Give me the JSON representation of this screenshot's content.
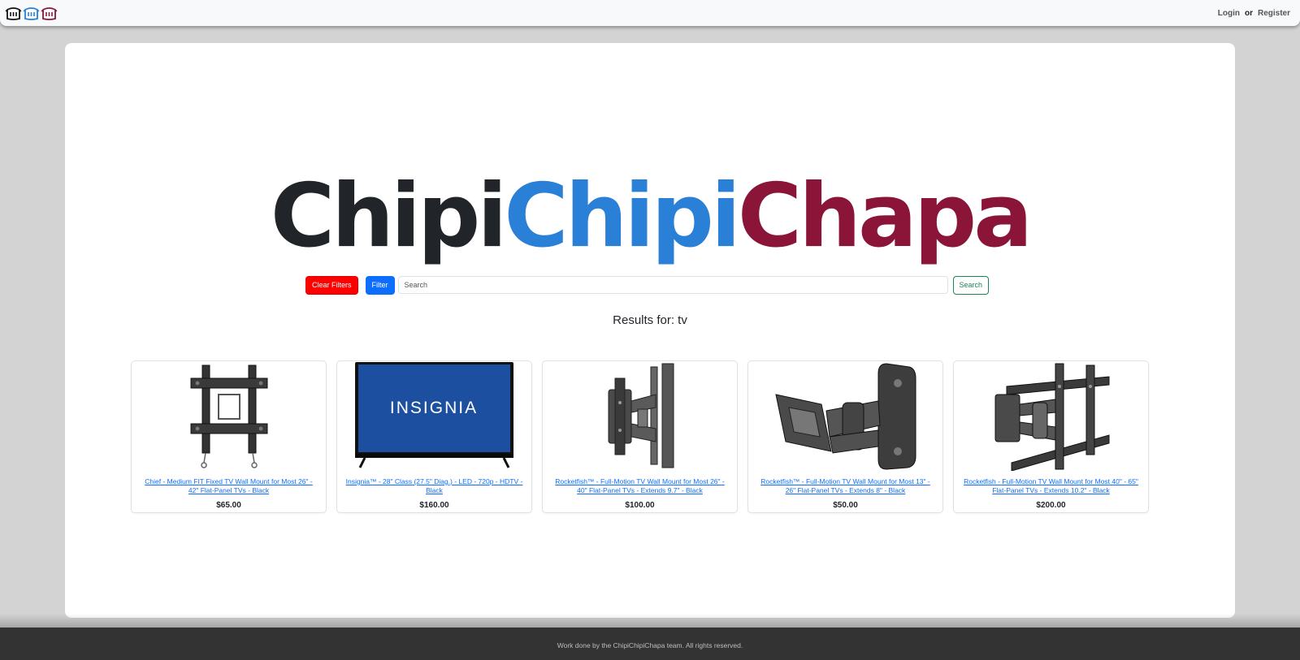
{
  "navbar": {
    "logo_icons": [
      "pot-icon-black",
      "pot-icon-blue",
      "pot-icon-maroon"
    ],
    "login_label": "Login",
    "or_label": "or",
    "register_label": "Register"
  },
  "brand": {
    "word1": "Chipi",
    "word2": "Chipi",
    "word3": "Chapa",
    "colors": [
      "#212529",
      "#2a7fd6",
      "#8b1538"
    ]
  },
  "search": {
    "clear_filters_label": "Clear Filters",
    "filter_label": "Filter",
    "placeholder": "Search",
    "value": "",
    "search_label": "Search"
  },
  "results": {
    "title": "Results for: tv"
  },
  "products": [
    {
      "name": "Chief - Medium FIT Fixed TV Wall Mount for Most 26\" - 42\" Flat-Panel TVs - Black",
      "price": "$65.00",
      "image": "fixed-wall-mount-image"
    },
    {
      "name": "Insignia™ - 28\" Class (27.5\" Diag.) - LED - 720p - HDTV - Black",
      "price": "$160.00",
      "image": "insignia-tv-image",
      "screen_text": "INSIGNIA"
    },
    {
      "name": "Rocketfish™ - Full-Motion TV Wall Mount for Most 26\" - 40\" Flat-Panel TVs - Extends 9.7\" - Black",
      "price": "$100.00",
      "image": "full-motion-mount-image"
    },
    {
      "name": "Rocketfish™ - Full-Motion TV Wall Mount for Most 13\" - 26\" Flat-Panel TVs - Extends 8\" - Black",
      "price": "$50.00",
      "image": "articulating-mount-image"
    },
    {
      "name": "Rocketfish - Full-Motion TV Wall Mount for Most 40\" - 65\" Flat-Panel TVs - Extends 10.2\" - Black",
      "price": "$200.00",
      "image": "large-full-motion-mount-image"
    }
  ],
  "footer": {
    "text": "Work done by the ChipiChipiChapa team. All rights reserved."
  }
}
